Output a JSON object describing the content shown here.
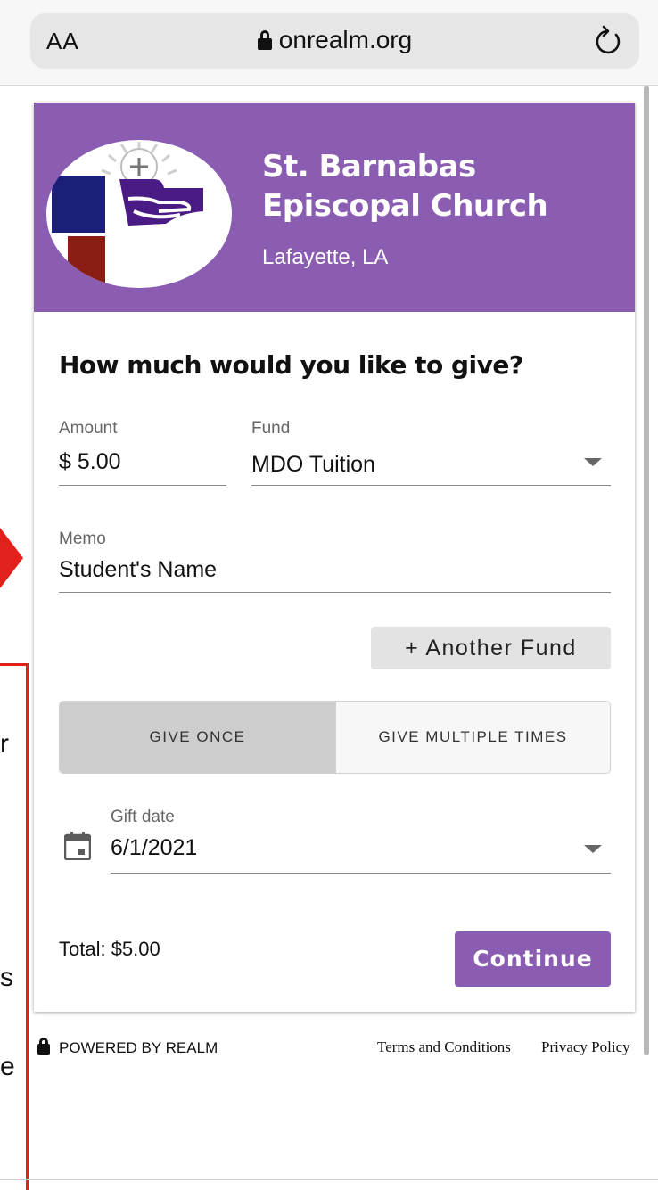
{
  "browser": {
    "text_size_label": "AA",
    "domain": "onrealm.org"
  },
  "church": {
    "name": "St. Barnabas Episcopal Church",
    "location": "Lafayette, LA"
  },
  "form": {
    "heading": "How much would you like to give?",
    "amount_label": "Amount",
    "amount_value": "$ 5.00",
    "fund_label": "Fund",
    "fund_value": "MDO Tuition",
    "memo_label": "Memo",
    "memo_value": "Student's Name",
    "another_fund_label": "+ Another Fund",
    "frequency_options": [
      "GIVE ONCE",
      "GIVE MULTIPLE TIMES"
    ],
    "frequency_selected": "GIVE ONCE",
    "gift_date_label": "Gift date",
    "gift_date_value": "6/1/2021",
    "total_label": "Total: $5.00",
    "continue_label": "Continue"
  },
  "footer": {
    "powered_by": "POWERED BY REALM",
    "terms": "Terms and Conditions",
    "privacy": "Privacy Policy"
  },
  "annotation": {
    "partial_letters": [
      "r",
      "s",
      "e"
    ]
  },
  "colors": {
    "brand_purple": "#8b5db2",
    "annotation_red": "#e3211c",
    "selected_toggle": "#cdcdcd"
  }
}
